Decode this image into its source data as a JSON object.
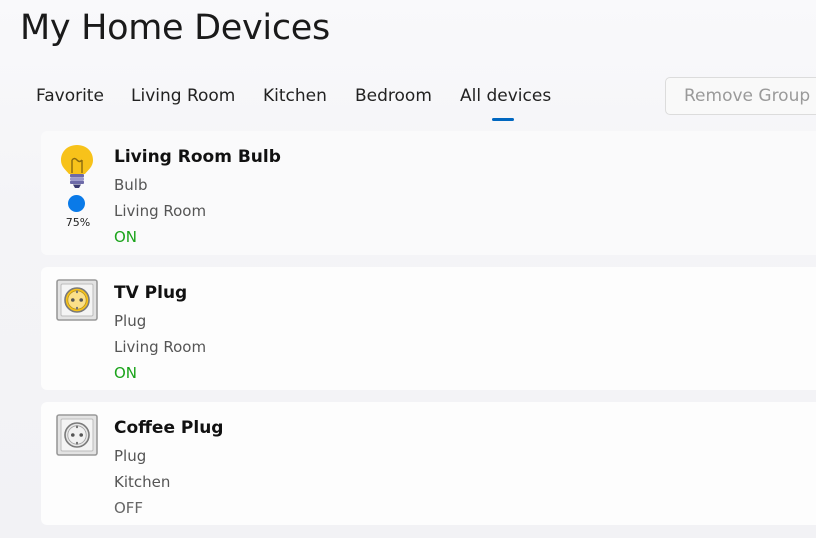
{
  "page": {
    "title": "My Home Devices"
  },
  "tabs": [
    {
      "label": "Favorite"
    },
    {
      "label": "Living Room"
    },
    {
      "label": "Kitchen"
    },
    {
      "label": "Bedroom"
    },
    {
      "label": "All devices",
      "selected": true
    }
  ],
  "toolbar": {
    "remove_group_label": "Remove Group",
    "remove_group_enabled": false
  },
  "colors": {
    "accent": "#0067c0",
    "on": "#1aa31a",
    "bulb": "#f7c21a",
    "brightness": "#0a7ae8"
  },
  "devices": [
    {
      "name": "Living Room Bulb",
      "type": "Bulb",
      "room": "Living Room",
      "status": "ON",
      "icon": "bulb-icon",
      "brightness_label": "75%",
      "brightness": 0.75
    },
    {
      "name": "TV Plug",
      "type": "Plug",
      "room": "Living Room",
      "status": "ON",
      "icon": "plug-on-icon"
    },
    {
      "name": "Coffee Plug",
      "type": "Plug",
      "room": "Kitchen",
      "status": "OFF",
      "icon": "plug-off-icon"
    }
  ]
}
